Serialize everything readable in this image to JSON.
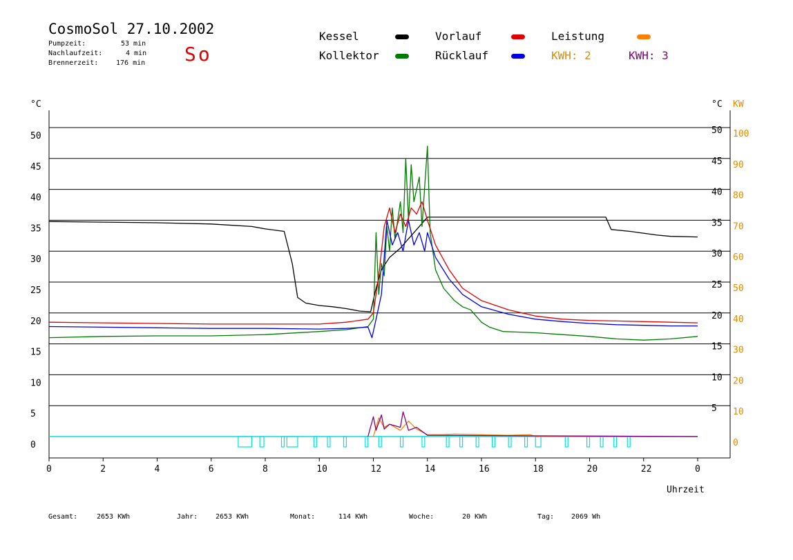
{
  "header": {
    "title": "CosmoSol 27.10.2002",
    "pumpzeit_label": "Pumpzeit:",
    "pumpzeit_value": "53 min",
    "nachlaufzeit_label": "Nachlaufzeit:",
    "nachlaufzeit_value": "4 min",
    "brennerzeit_label": "Brennerzeit:",
    "brennerzeit_value": "176 min",
    "weekday": "So"
  },
  "legend": {
    "kessel": "Kessel",
    "kollektor": "Kollektor",
    "vorlauf": "Vorlauf",
    "ruecklauf": "Rücklauf",
    "leistung": "Leistung",
    "kwh2": "KWH: 2",
    "kwh3": "KWH: 3"
  },
  "colors": {
    "kessel": "#000000",
    "kollektor": "#007a00",
    "vorlauf": "#e00000",
    "ruecklauf": "#0000e0",
    "leistung": "#ff8000",
    "kwh2": "#e08a00",
    "kwh3": "#800080",
    "pump": "#00e0e0"
  },
  "totals": {
    "gesamt_label": "Gesamt:",
    "gesamt_value": "2653 KWh",
    "jahr_label": "Jahr:",
    "jahr_value": "2653 KWh",
    "monat_label": "Monat:",
    "monat_value": "114 KWh",
    "woche_label": "Woche:",
    "woche_value": "20 KWh",
    "tag_label": "Tag:",
    "tag_value": "2069 Wh"
  },
  "chart_data": {
    "type": "line",
    "xlabel": "Uhrzeit",
    "ylabel_left": "°C",
    "ylabel_right_c": "°C",
    "ylabel_right_kw": "KW",
    "x_ticks": [
      "0",
      "2",
      "4",
      "6",
      "8",
      "10",
      "12",
      "14",
      "16",
      "18",
      "20",
      "22",
      "0"
    ],
    "x_range": [
      0,
      24
    ],
    "y_left_ticks": [
      0,
      5,
      10,
      15,
      20,
      25,
      30,
      35,
      40,
      45,
      50
    ],
    "y_right_c_ticks": [
      5,
      10,
      15,
      20,
      25,
      30,
      35,
      40,
      45,
      50
    ],
    "y_right_kw_ticks": [
      0,
      10,
      20,
      30,
      40,
      50,
      60,
      70,
      80,
      90,
      100
    ],
    "ylim": [
      0,
      50
    ],
    "grid": true,
    "series": [
      {
        "name": "Kessel",
        "color_key": "kessel",
        "points": [
          [
            0,
            34.8
          ],
          [
            2,
            34.7
          ],
          [
            4,
            34.6
          ],
          [
            6,
            34.4
          ],
          [
            7.5,
            34
          ],
          [
            8,
            33.6
          ],
          [
            8.7,
            33.2
          ],
          [
            9,
            28
          ],
          [
            9.2,
            22.5
          ],
          [
            9.5,
            21.6
          ],
          [
            10,
            21.2
          ],
          [
            10.5,
            21
          ],
          [
            11,
            20.7
          ],
          [
            11.5,
            20.3
          ],
          [
            11.9,
            20.2
          ],
          [
            12.1,
            24
          ],
          [
            12.3,
            27
          ],
          [
            12.6,
            29
          ],
          [
            13,
            30.5
          ],
          [
            13.5,
            33
          ],
          [
            14,
            35.5
          ],
          [
            15,
            35.5
          ],
          [
            18,
            35.5
          ],
          [
            20.6,
            35.5
          ],
          [
            20.8,
            33.5
          ],
          [
            21.5,
            33.2
          ],
          [
            22.5,
            32.6
          ],
          [
            23,
            32.4
          ],
          [
            24,
            32.3
          ]
        ]
      },
      {
        "name": "Kollektor",
        "color_key": "kollektor",
        "points": [
          [
            0,
            16
          ],
          [
            2,
            16.2
          ],
          [
            4,
            16.3
          ],
          [
            6,
            16.3
          ],
          [
            8,
            16.5
          ],
          [
            10,
            17
          ],
          [
            11,
            17.3
          ],
          [
            11.8,
            17.8
          ],
          [
            12,
            19
          ],
          [
            12.1,
            33
          ],
          [
            12.2,
            23
          ],
          [
            12.3,
            28
          ],
          [
            12.4,
            26
          ],
          [
            12.5,
            34
          ],
          [
            12.6,
            30
          ],
          [
            12.7,
            37
          ],
          [
            12.8,
            32
          ],
          [
            13,
            38
          ],
          [
            13.1,
            33
          ],
          [
            13.2,
            45
          ],
          [
            13.3,
            35
          ],
          [
            13.4,
            44
          ],
          [
            13.5,
            38
          ],
          [
            13.7,
            42
          ],
          [
            13.8,
            34
          ],
          [
            14,
            47
          ],
          [
            14.1,
            33
          ],
          [
            14.3,
            27
          ],
          [
            14.6,
            24
          ],
          [
            15,
            22
          ],
          [
            15.3,
            21
          ],
          [
            15.6,
            20.5
          ],
          [
            16,
            18.5
          ],
          [
            16.3,
            17.7
          ],
          [
            16.8,
            17
          ],
          [
            18,
            16.8
          ],
          [
            19,
            16.5
          ],
          [
            20,
            16.2
          ],
          [
            21,
            15.8
          ],
          [
            22,
            15.6
          ],
          [
            23,
            15.8
          ],
          [
            24,
            16.2
          ]
        ]
      },
      {
        "name": "Vorlauf",
        "color_key": "vorlauf",
        "points": [
          [
            0,
            18.5
          ],
          [
            2,
            18.4
          ],
          [
            4,
            18.3
          ],
          [
            6,
            18.2
          ],
          [
            8,
            18.2
          ],
          [
            10,
            18.2
          ],
          [
            11,
            18.5
          ],
          [
            11.8,
            19
          ],
          [
            12,
            20
          ],
          [
            12.2,
            26
          ],
          [
            12.4,
            34
          ],
          [
            12.6,
            37
          ],
          [
            12.8,
            33
          ],
          [
            13,
            36
          ],
          [
            13.2,
            34
          ],
          [
            13.4,
            37
          ],
          [
            13.6,
            36
          ],
          [
            13.8,
            38
          ],
          [
            14,
            35
          ],
          [
            14.3,
            31
          ],
          [
            14.8,
            27
          ],
          [
            15.3,
            24
          ],
          [
            16,
            22
          ],
          [
            17,
            20.5
          ],
          [
            18,
            19.5
          ],
          [
            19,
            19
          ],
          [
            20,
            18.8
          ],
          [
            21,
            18.7
          ],
          [
            22,
            18.6
          ],
          [
            23,
            18.5
          ],
          [
            24,
            18.4
          ]
        ]
      },
      {
        "name": "Rücklauf",
        "color_key": "ruecklauf",
        "points": [
          [
            0,
            17.8
          ],
          [
            2,
            17.7
          ],
          [
            4,
            17.6
          ],
          [
            6,
            17.5
          ],
          [
            8,
            17.5
          ],
          [
            10,
            17.4
          ],
          [
            11,
            17.5
          ],
          [
            11.8,
            17.7
          ],
          [
            11.95,
            16
          ],
          [
            12.1,
            19
          ],
          [
            12.3,
            23
          ],
          [
            12.5,
            35
          ],
          [
            12.7,
            31
          ],
          [
            12.9,
            33
          ],
          [
            13.1,
            30
          ],
          [
            13.3,
            35
          ],
          [
            13.5,
            31
          ],
          [
            13.7,
            33
          ],
          [
            13.9,
            30
          ],
          [
            14,
            33
          ],
          [
            14.3,
            29
          ],
          [
            14.8,
            25.5
          ],
          [
            15.3,
            23
          ],
          [
            16,
            21
          ],
          [
            17,
            19.8
          ],
          [
            18,
            19
          ],
          [
            19,
            18.6
          ],
          [
            20,
            18.3
          ],
          [
            21,
            18.1
          ],
          [
            22,
            18
          ],
          [
            23,
            17.9
          ],
          [
            24,
            17.9
          ]
        ]
      },
      {
        "name": "Leistung",
        "color_key": "leistung",
        "points": [
          [
            12,
            0
          ],
          [
            12.2,
            3
          ],
          [
            12.4,
            1.5
          ],
          [
            12.6,
            2
          ],
          [
            13,
            1
          ],
          [
            13.3,
            2.5
          ],
          [
            13.6,
            1.2
          ],
          [
            14,
            0.3
          ],
          [
            14.5,
            0.3
          ],
          [
            15,
            0.4
          ],
          [
            16,
            0.3
          ],
          [
            17,
            0.2
          ],
          [
            17.8,
            0.3
          ],
          [
            18,
            0
          ],
          [
            24,
            0
          ]
        ]
      },
      {
        "name": "KWH: 3",
        "color_key": "kwh3",
        "points": [
          [
            11.8,
            0
          ],
          [
            12,
            3.2
          ],
          [
            12.1,
            1
          ],
          [
            12.3,
            3.5
          ],
          [
            12.4,
            1.2
          ],
          [
            12.6,
            2
          ],
          [
            13,
            1.5
          ],
          [
            13.1,
            4
          ],
          [
            13.3,
            1
          ],
          [
            13.6,
            1.5
          ],
          [
            14,
            0.2
          ],
          [
            24,
            0
          ]
        ]
      }
    ],
    "pump_on_hours": [
      [
        7,
        7.5
      ],
      [
        7.8,
        7.95
      ],
      [
        8.6,
        8.7
      ],
      [
        8.8,
        9.2
      ],
      [
        9.8,
        9.9
      ],
      [
        10.3,
        10.4
      ],
      [
        10.9,
        11
      ],
      [
        11.7,
        11.8
      ],
      [
        12.2,
        12.3
      ],
      [
        13,
        13.1
      ],
      [
        13.8,
        13.9
      ],
      [
        14.7,
        14.8
      ],
      [
        15.2,
        15.3
      ],
      [
        15.8,
        15.9
      ],
      [
        16.4,
        16.5
      ],
      [
        17,
        17.1
      ],
      [
        17.6,
        17.7
      ],
      [
        18,
        18.2
      ],
      [
        19.1,
        19.2
      ],
      [
        19.9,
        20
      ],
      [
        20.4,
        20.5
      ],
      [
        20.9,
        21
      ],
      [
        21.4,
        21.5
      ]
    ]
  }
}
